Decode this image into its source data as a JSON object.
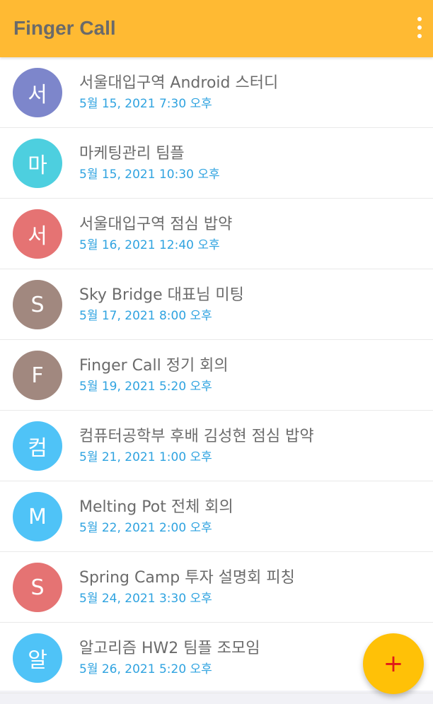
{
  "header": {
    "title": "Finger Call",
    "menu_icon": "more-vert-icon"
  },
  "meetings": [
    {
      "initial": "서",
      "title": "서울대입구역 Android 스터디",
      "datetime": "5월 15, 2021  7:30 오후",
      "color": "#7d86cb"
    },
    {
      "initial": "마",
      "title": "마케팅관리 팀플",
      "datetime": "5월 15, 2021  10:30 오후",
      "color": "#4dcfdf"
    },
    {
      "initial": "서",
      "title": "서울대입구역 점심 밥약",
      "datetime": "5월 16, 2021  12:40 오후",
      "color": "#e57373"
    },
    {
      "initial": "S",
      "title": "Sky Bridge 대표님 미팅",
      "datetime": "5월 17, 2021  8:00 오후",
      "color": "#a1887f"
    },
    {
      "initial": "F",
      "title": "Finger Call 정기 회의",
      "datetime": "5월 19, 2021  5:20 오후",
      "color": "#a1887f"
    },
    {
      "initial": "컴",
      "title": "컴퓨터공학부 후배 김성현 점심 밥약",
      "datetime": "5월 21, 2021  1:00 오후",
      "color": "#4fc3f7"
    },
    {
      "initial": "M",
      "title": "Melting Pot  전체 회의",
      "datetime": "5월 22, 2021  2:00 오후",
      "color": "#4fc3f7"
    },
    {
      "initial": "S",
      "title": "Spring Camp 투자 설명회 피칭",
      "datetime": "5월 24, 2021  3:30 오후",
      "color": "#e57373"
    },
    {
      "initial": "알",
      "title": "알고리즘 HW2 팀플 조모임",
      "datetime": "5월 26, 2021  5:20 오후",
      "color": "#4fc3f7"
    }
  ],
  "fab": {
    "label": "+",
    "icon": "plus-icon"
  },
  "colors": {
    "appbar": "#ffba33",
    "fab": "#ffc107",
    "fab_icon": "#e01919",
    "datetime_text": "#2fa3e0"
  }
}
